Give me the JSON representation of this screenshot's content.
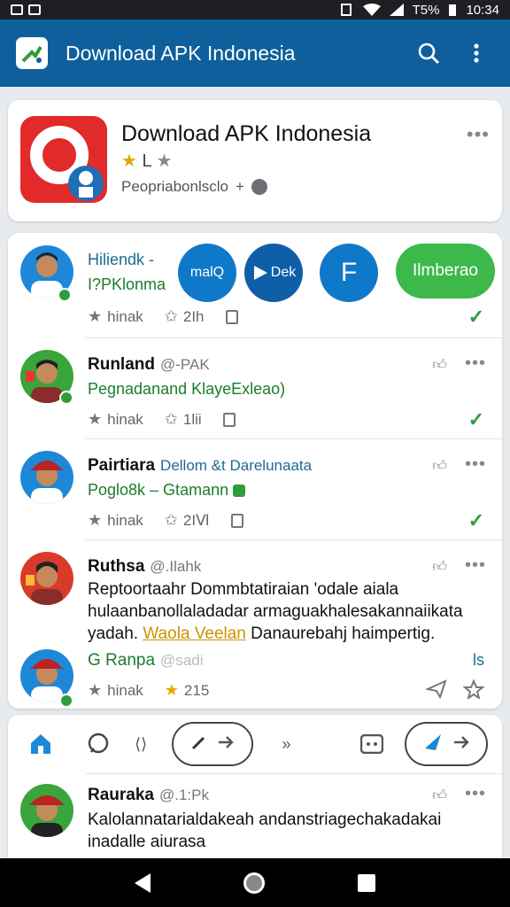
{
  "status_bar": {
    "battery": "T5%",
    "time": "10:34"
  },
  "app_bar": {
    "title": "Download APK Indonesia",
    "icons": [
      "app-logo-icon",
      "search-icon",
      "more-vert-icon"
    ]
  },
  "header": {
    "title": "Download APK Indonesia",
    "stars": [
      "★",
      "L",
      "★"
    ],
    "subtitle": "Peopriabonlsclo",
    "subtitle_suffix": "+",
    "more": "•••"
  },
  "feed": {
    "first": {
      "line1": "Hiliendk -",
      "line2": "I?PKlonma",
      "bubble1": "malQ",
      "bubble2": "Dek",
      "bubble3": "F",
      "pill": "Ilmberao",
      "action1": "hinak",
      "action2": "2Ih"
    },
    "posts": [
      {
        "name": "Runland",
        "handle": "@-PAK",
        "line": "Pegnadanand KlayeExleao)",
        "action1": "hinak",
        "action2": "1lii"
      },
      {
        "name": "Pairtiara",
        "handle": "Dellom &t Darelunaata",
        "line": "Poglo8k – Gtamann",
        "action1": "hinak",
        "action2": "2IⅥ"
      },
      {
        "name": "Ruthsa",
        "handle": "@.Ilahk",
        "text1": "Reptoortaahr Dommbtatiraian 'odale aiala",
        "text2": "hulaanbanollaladadar armaguakhalesakannaiikata",
        "text3_a": "yadah.",
        "text3_hl": "Waola Veelan",
        "text3_b": "Danaurebahj haimpertig."
      },
      {
        "name": "G Ranpa",
        "handle": "@sadi",
        "tag": "ls",
        "action1": "hinak",
        "action2": "215"
      }
    ]
  },
  "last_post": {
    "name": "Rauraka",
    "handle": "@.1:Pk",
    "text1": "Kalolannatarialdakeah andanstriagechakadakai",
    "text2": "inadalle aiurasa"
  },
  "toolbar_icons": [
    "home-icon",
    "chat-icon",
    "code-icon",
    "pencil-icon",
    "forward-icon",
    "skip-icon",
    "terminal-icon",
    "send-icon",
    "arrow-icon"
  ],
  "colors": {
    "app_bar": "#0e5f9c",
    "accent_green": "#2e9d3a",
    "accent_blue": "#1078c8"
  }
}
